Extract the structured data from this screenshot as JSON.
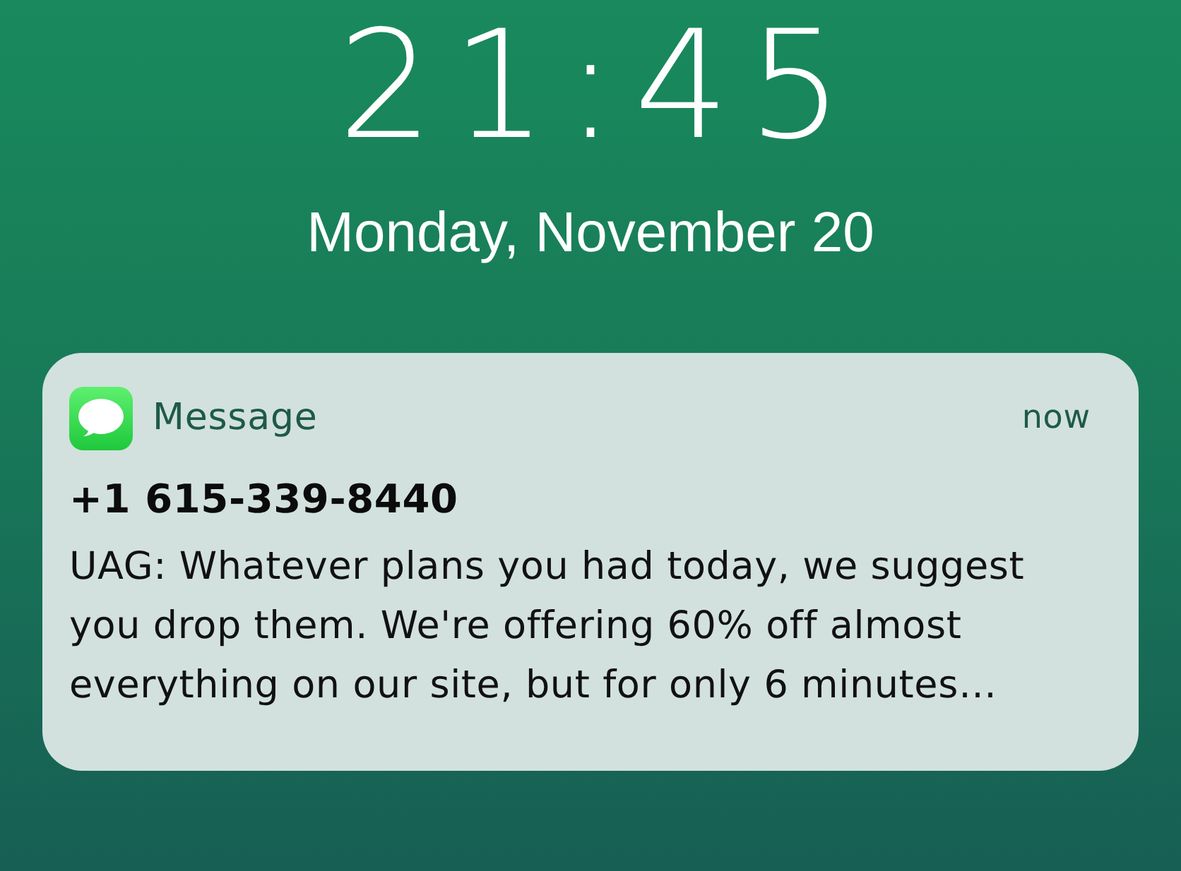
{
  "lock_screen": {
    "time": "21:45",
    "date": "Monday, November 20"
  },
  "notifications": [
    {
      "app": "Message",
      "time": "now",
      "sender": "+1 615-339-8440",
      "body": "UAG: Whatever plans you had today, we suggest you drop them. We're offering 60% off almost everything on our site, but for only 6 minutes…"
    }
  ]
}
